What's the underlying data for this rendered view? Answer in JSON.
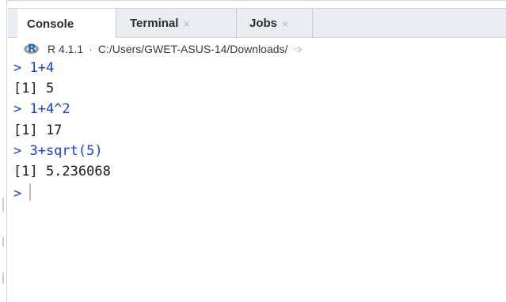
{
  "tabs": [
    {
      "label": "Console",
      "closable": false,
      "active": true
    },
    {
      "label": "Terminal",
      "closable": true,
      "close_icon": "×",
      "active": false
    },
    {
      "label": "Jobs",
      "closable": true,
      "close_icon": "×",
      "active": false
    }
  ],
  "pathbar": {
    "r_logo_letter": "R",
    "version": "R 4.1.1",
    "separator": "·",
    "path": "C:/Users/GWET-ASUS-14/Downloads/",
    "nav_icon": "go-to-directory-icon",
    "nav_glyph": "➩"
  },
  "console": {
    "prompt": ">",
    "lines": [
      {
        "kind": "input",
        "text": "> 1+4"
      },
      {
        "kind": "output",
        "text": "[1] 5"
      },
      {
        "kind": "input",
        "text": "> 1+4^2"
      },
      {
        "kind": "output",
        "text": "[1] 17"
      },
      {
        "kind": "input",
        "text": "> 3+sqrt(5)"
      },
      {
        "kind": "output",
        "text": "[1] 5.236068"
      }
    ]
  },
  "colors": {
    "input_text": "#1440e0",
    "output_text": "#1a1a1a",
    "tabbar_bg": "#e9edf2",
    "r_logo_blue": "#1f65b7"
  }
}
